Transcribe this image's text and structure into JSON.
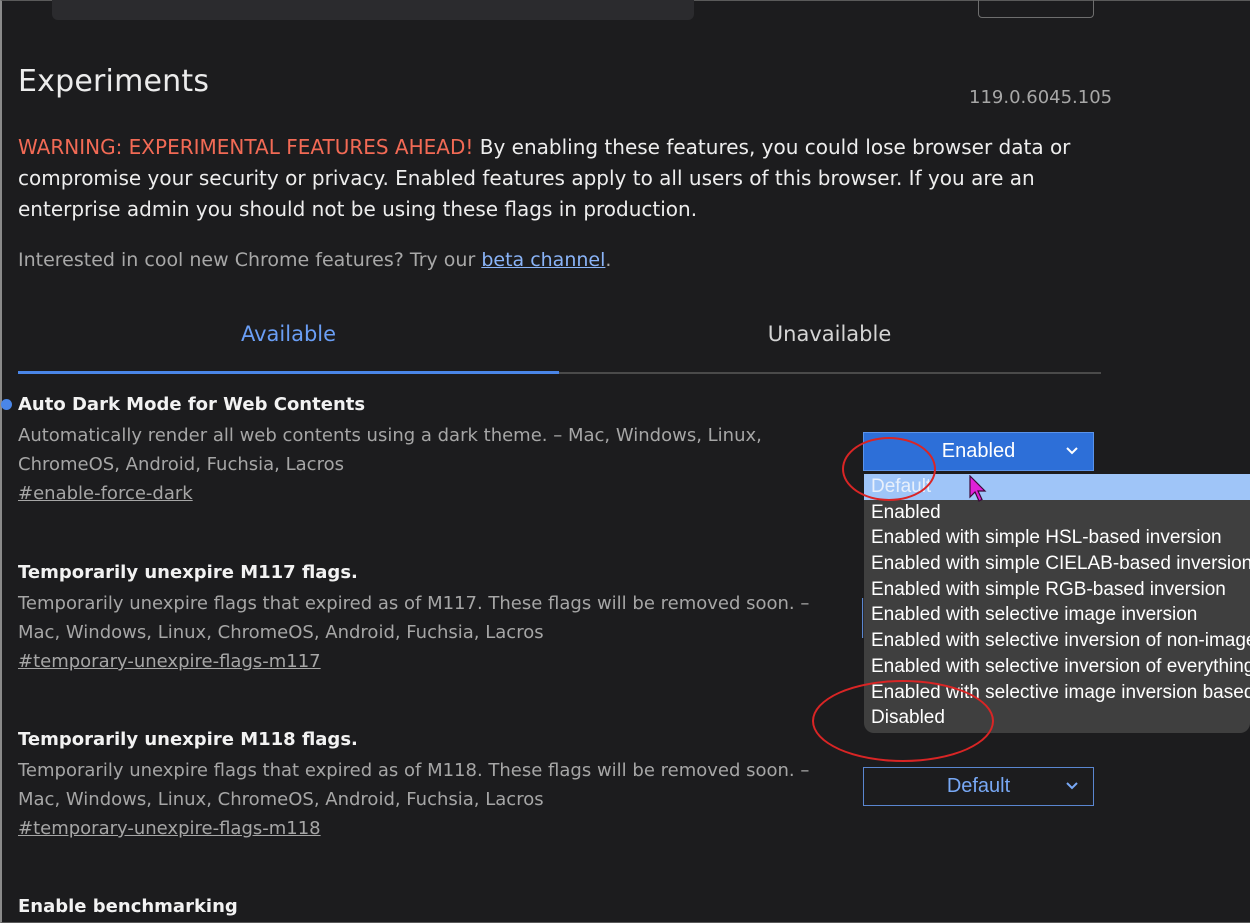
{
  "header": {
    "title": "Experiments",
    "version": "119.0.6045.105"
  },
  "warning": {
    "label": "WARNING: EXPERIMENTAL FEATURES AHEAD!",
    "text": " By enabling these features, you could lose browser data or compromise your security or privacy. Enabled features apply to all users of this browser. If you are an enterprise admin you should not be using these flags in production."
  },
  "promo": {
    "text": "Interested in cool new Chrome features? Try our ",
    "link": "beta channel",
    "suffix": "."
  },
  "tabs": [
    {
      "label": "Available",
      "active": true
    },
    {
      "label": "Unavailable",
      "active": false
    }
  ],
  "flags": [
    {
      "title": "Auto Dark Mode for Web Contents",
      "description": "Automatically render all web contents using a dark theme. – Mac, Windows, Linux, ChromeOS, Android, Fuchsia, Lacros",
      "link": "#enable-force-dark",
      "value": "Enabled"
    },
    {
      "title": "Temporarily unexpire M117 flags.",
      "description": "Temporarily unexpire flags that expired as of M117. These flags will be removed soon. – Mac, Windows, Linux, ChromeOS, Android, Fuchsia, Lacros",
      "link": "#temporary-unexpire-flags-m117"
    },
    {
      "title": "Temporarily unexpire M118 flags.",
      "description": "Temporarily unexpire flags that expired as of M118. These flags will be removed soon. – Mac, Windows, Linux, ChromeOS, Android, Fuchsia, Lacros",
      "link": "#temporary-unexpire-flags-m118",
      "value": "Default"
    },
    {
      "title": "Enable benchmarking"
    }
  ],
  "dropdown": {
    "options": [
      "Default",
      "Enabled",
      "Enabled with simple HSL-based inversion",
      "Enabled with simple CIELAB-based inversion",
      "Enabled with simple RGB-based inversion",
      "Enabled with selective image inversion",
      "Enabled with selective inversion of non-image elements",
      "Enabled with selective inversion of everything",
      "Enabled with selective image inversion based on image classifier",
      "Disabled"
    ],
    "highlighted": "Default"
  },
  "colors": {
    "accent": "#4a86e8",
    "warning": "#f26a55",
    "annotation": "#d92525"
  },
  "icons": {
    "chevron": "chevron-down-icon",
    "cursor": "mouse-pointer-icon"
  }
}
